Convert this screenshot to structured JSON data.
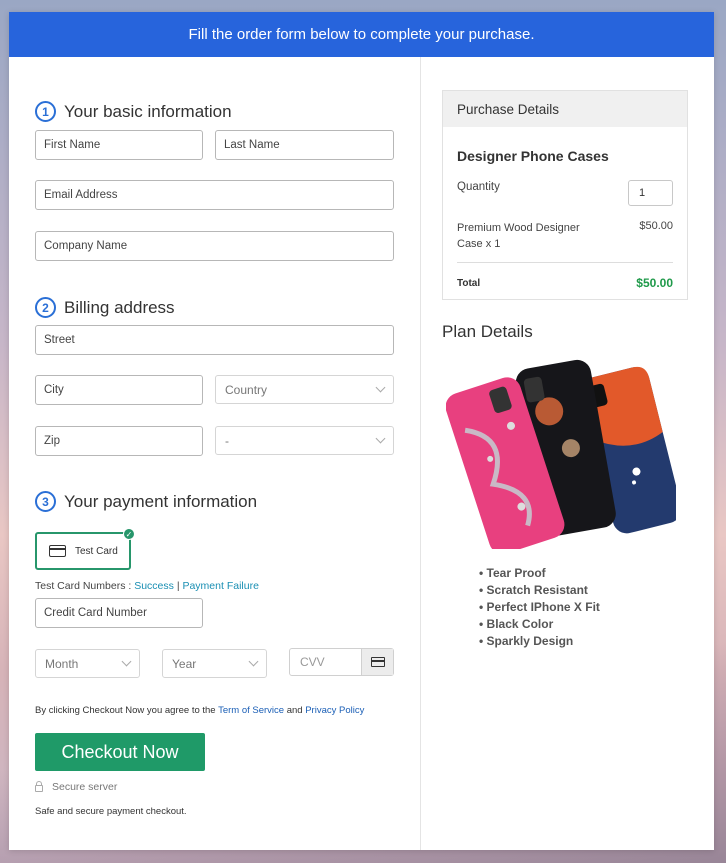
{
  "banner": "Fill the order form below to complete your purchase.",
  "sections": {
    "s1_num": "1",
    "s1": "Your basic information",
    "s2_num": "2",
    "s2": "Billing address",
    "s3_num": "3",
    "s3": "Your payment information"
  },
  "fields": {
    "first_name": "First Name",
    "last_name": "Last Name",
    "email": "Email Address",
    "company": "Company Name",
    "street": "Street",
    "city": "City",
    "country": "Country",
    "zip": "Zip",
    "state": "-",
    "card_number": "Credit Card Number",
    "month": "Month",
    "year": "Year",
    "cvv": "CVV"
  },
  "payment": {
    "test_card": "Test Card",
    "test_numbers_label": "Test Card Numbers : ",
    "success": "Success",
    "sep": "|",
    "failure": "Payment Failure"
  },
  "legal": {
    "prefix": "By clicking Checkout Now you agree to the ",
    "tos": "Term of Service",
    "and": " and ",
    "privacy": "Privacy Policy"
  },
  "checkout": {
    "button": "Checkout Now",
    "secure": "Secure server",
    "safe": "Safe and secure payment checkout."
  },
  "purchase": {
    "header": "Purchase Details",
    "product": "Designer Phone Cases",
    "quantity_label": "Quantity",
    "quantity": "1",
    "item": "Premium Wood Designer Case x 1",
    "item_price": "$50.00",
    "total_label": "Total",
    "total": "$50.00"
  },
  "plan": {
    "title": "Plan Details",
    "features": [
      "Tear Proof",
      "Scratch Resistant",
      "Perfect IPhone X Fit",
      "Black Color",
      "Sparkly Design"
    ]
  },
  "colors": {
    "banner": "#2764dc",
    "accent": "#2a6fd6",
    "checkout": "#1f9a68",
    "total": "#1f9a4a"
  }
}
